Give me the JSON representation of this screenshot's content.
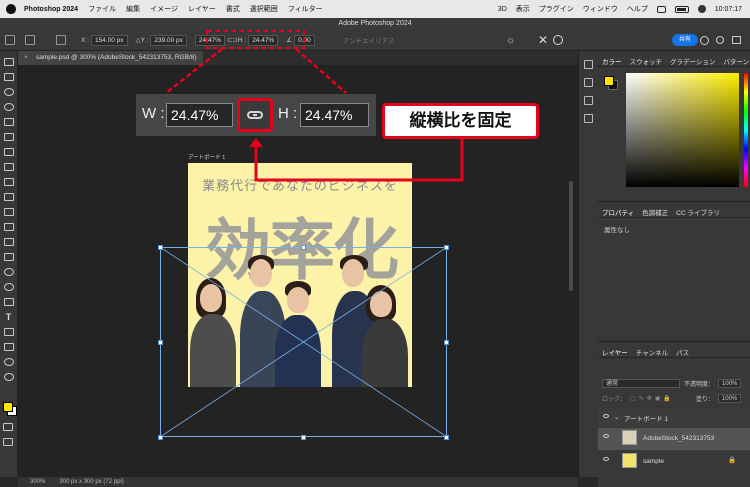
{
  "menubar": {
    "app_name": "Photoshop 2024",
    "items": [
      "ファイル",
      "編集",
      "イメージ",
      "レイヤー",
      "書式",
      "選択範囲",
      "フィルター"
    ],
    "right_items": [
      "3D",
      "表示",
      "プラグイン",
      "ウィンドウ",
      "ヘルプ"
    ],
    "clock": "10:07:17"
  },
  "window": {
    "title": "Adobe Photoshop 2024"
  },
  "options_bar": {
    "x_label": "X :",
    "x_value": "154.00 px",
    "y_label": "Y :",
    "y_value": "239.00 px",
    "w_value": "24.47%",
    "h_label": "H :",
    "h_value": "24.47%",
    "angle_value": "0.00",
    "antialias": "アンチエイリアス",
    "share": "共有"
  },
  "document_tab": {
    "label": "sample.psd @ 300% (AdobeStock_542313753, RGB/8)"
  },
  "zoom_panel": {
    "w_label": "W :",
    "w_value": "24.47%",
    "h_label": "H :",
    "h_value": "24.47%"
  },
  "callout": {
    "text": "縦横比を固定"
  },
  "artboard": {
    "label": "アートボード 1",
    "headline": "業務代行であなたのビジネスを",
    "big_text": "効率化"
  },
  "status_bar": {
    "zoom": "300%",
    "size": "300 px x 300 px (72 ppi)"
  },
  "panels": {
    "color_tabs": [
      "カラー",
      "スウォッチ",
      "グラデーション",
      "パターン"
    ],
    "props_tabs": [
      "プロパティ",
      "色調補正",
      "CC ライブラリ"
    ],
    "props_empty": "属性なし",
    "layers_tabs": [
      "レイヤー",
      "チャンネル",
      "パス"
    ],
    "blend_mode": "通常",
    "opacity_label": "不透明度：",
    "opacity_value": "100%",
    "lock_label": "ロック：",
    "fill_label": "塗り：",
    "fill_value": "100%",
    "layers": [
      {
        "name": "アートボード 1"
      },
      {
        "name": "AdobeStock_542313753"
      },
      {
        "name": "sample"
      }
    ]
  },
  "colors": {
    "accent_red": "#e8001c",
    "foreground": "#ffe600",
    "transform_line": "#7ab0e8"
  }
}
